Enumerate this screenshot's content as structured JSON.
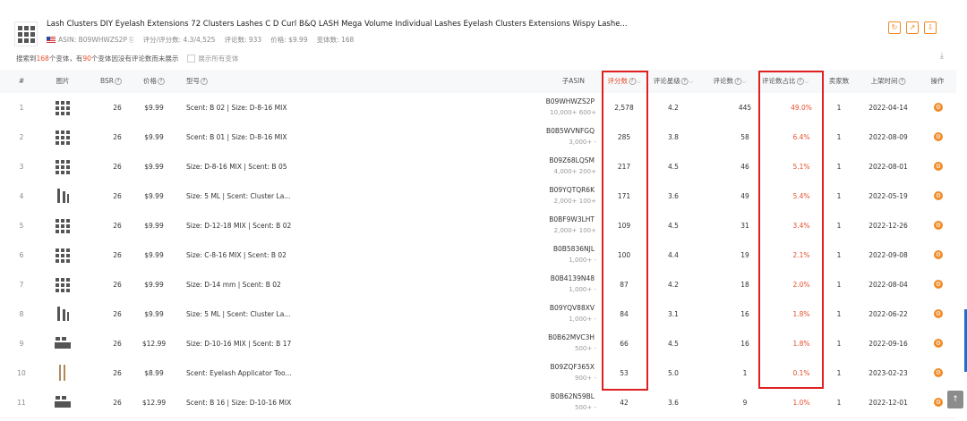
{
  "header": {
    "title": "Lash Clusters DIY Eyelash Extensions 72 Clusters Lashes C D Curl B&Q LASH Mega Volume Individual Lashes Eyelash Clusters Extensions Wispy Lashe...",
    "asin_label": "ASIN: B09WHWZS2P",
    "copy_icon": "⎘",
    "rating_label": "评分/评分数: 4.3/4,525",
    "reviews_label": "评论数: 933",
    "price_label": "价格: $9.99",
    "variants_label": "变体数: 168",
    "tools": [
      {
        "icon": "refresh-icon",
        "glyph": "↻"
      },
      {
        "icon": "share-icon",
        "glyph": "↗"
      },
      {
        "icon": "export-icon",
        "glyph": "⇩"
      }
    ]
  },
  "summary": {
    "prefix": "搜索到",
    "found": "168",
    "mid": "个变体，有",
    "hidden": "90",
    "suffix": "个变体因没有评论数而未展示",
    "show_all": "展示所有变体",
    "download_glyph": "⤓"
  },
  "columns": {
    "index": "#",
    "image": "图片",
    "bsr": "BSR",
    "price": "价格",
    "model": "型号",
    "asin": "子ASIN",
    "ratings": "评分数",
    "stars": "评论星级",
    "reviews": "评论数",
    "review_ratio": "评论数占比",
    "sellers": "卖家数",
    "listed": "上架时间",
    "action": "操作",
    "help_glyph": "?",
    "sort_glyph": "⌵"
  },
  "rows": [
    {
      "idx": "1",
      "bsr": "26",
      "price": "$9.99",
      "model": "Scent: B 02 | Size: D-8-16 MIX",
      "asin": "B09WHWZS2P",
      "sales": "10,000+   600+",
      "ratings": "2,578",
      "stars": "4.2",
      "reviews": "445",
      "ratio": "49.0%",
      "sellers": "1",
      "listed": "2022-04-14"
    },
    {
      "idx": "2",
      "bsr": "26",
      "price": "$9.99",
      "model": "Scent: B 01 | Size: D-8-16 MIX",
      "asin": "B0B5WVNFGQ",
      "sales": "3,000+     -",
      "ratings": "285",
      "stars": "3.8",
      "reviews": "58",
      "ratio": "6.4%",
      "sellers": "1",
      "listed": "2022-08-09"
    },
    {
      "idx": "3",
      "bsr": "26",
      "price": "$9.99",
      "model": "Size: D-8-16 MIX | Scent: B 05",
      "asin": "B09Z68LQSM",
      "sales": "4,000+   200+",
      "ratings": "217",
      "stars": "4.5",
      "reviews": "46",
      "ratio": "5.1%",
      "sellers": "1",
      "listed": "2022-08-01"
    },
    {
      "idx": "4",
      "bsr": "26",
      "price": "$9.99",
      "model": "Size: 5 ML | Scent: Cluster La...",
      "asin": "B09YQTQR6K",
      "sales": "2,000+   100+",
      "ratings": "171",
      "stars": "3.6",
      "reviews": "49",
      "ratio": "5.4%",
      "sellers": "1",
      "listed": "2022-05-19"
    },
    {
      "idx": "5",
      "bsr": "26",
      "price": "$9.99",
      "model": "Size: D-12-18 MIX | Scent: B 02",
      "asin": "B0BF9W3LHT",
      "sales": "2,000+   100+",
      "ratings": "109",
      "stars": "4.5",
      "reviews": "31",
      "ratio": "3.4%",
      "sellers": "1",
      "listed": "2022-12-26"
    },
    {
      "idx": "6",
      "bsr": "26",
      "price": "$9.99",
      "model": "Size: C-8-16 MIX | Scent: B 02",
      "asin": "B0B5836NJL",
      "sales": "1,000+     -",
      "ratings": "100",
      "stars": "4.4",
      "reviews": "19",
      "ratio": "2.1%",
      "sellers": "1",
      "listed": "2022-09-08"
    },
    {
      "idx": "7",
      "bsr": "26",
      "price": "$9.99",
      "model": "Size: D-14 mm | Scent: B 02",
      "asin": "B0B4139N48",
      "sales": "1,000+     -",
      "ratings": "87",
      "stars": "4.2",
      "reviews": "18",
      "ratio": "2.0%",
      "sellers": "1",
      "listed": "2022-08-04"
    },
    {
      "idx": "8",
      "bsr": "26",
      "price": "$9.99",
      "model": "Size: 5 ML | Scent: Cluster La...",
      "asin": "B09YQV88XV",
      "sales": "1,000+     -",
      "ratings": "84",
      "stars": "3.1",
      "reviews": "16",
      "ratio": "1.8%",
      "sellers": "1",
      "listed": "2022-06-22"
    },
    {
      "idx": "9",
      "bsr": "26",
      "price": "$12.99",
      "model": "Size: D-10-16 MIX | Scent: B 17",
      "asin": "B0B62MVC3H",
      "sales": "500+     -",
      "ratings": "66",
      "stars": "4.5",
      "reviews": "16",
      "ratio": "1.8%",
      "sellers": "1",
      "listed": "2022-09-16"
    },
    {
      "idx": "10",
      "bsr": "26",
      "price": "$8.99",
      "model": "Scent: Eyelash Applicator Too...",
      "asin": "B09ZQF365X",
      "sales": "900+     -",
      "ratings": "53",
      "stars": "5.0",
      "reviews": "1",
      "ratio": "0.1%",
      "sellers": "1",
      "listed": "2023-02-23"
    },
    {
      "idx": "11",
      "bsr": "26",
      "price": "$12.99",
      "model": "Scent: B 16 | Size: D-10-16 MIX",
      "asin": "B0B62N59BL",
      "sales": "500+     -",
      "ratings": "42",
      "stars": "3.6",
      "reviews": "9",
      "ratio": "1.0%",
      "sellers": "1",
      "listed": "2022-12-01"
    }
  ],
  "action_glyph": "⚙",
  "back_to_top_glyph": "↑",
  "colors": {
    "accent": "#f08a24",
    "highlight": "#e02020",
    "ratio": "#e8502e"
  }
}
